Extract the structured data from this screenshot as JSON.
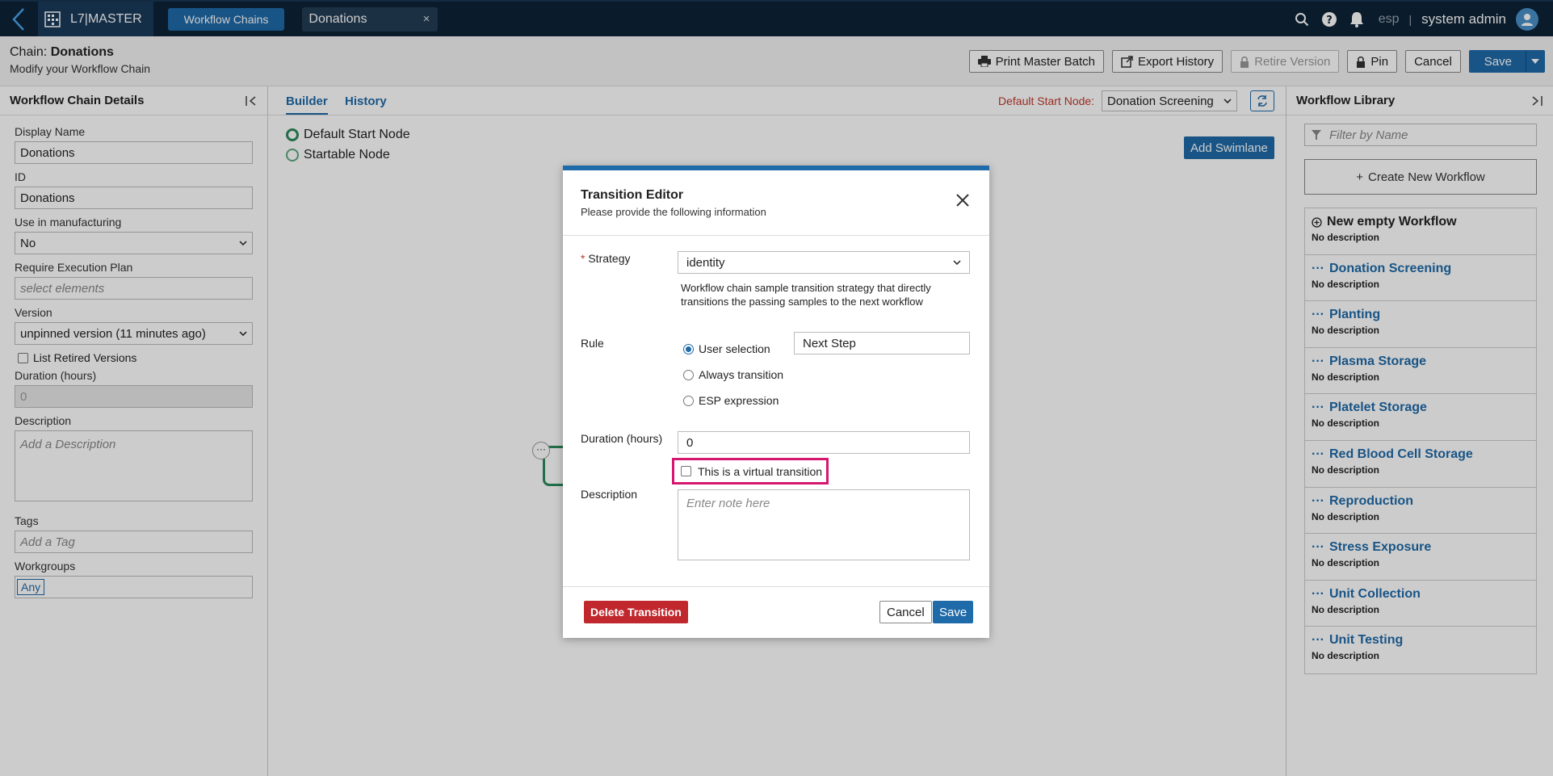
{
  "topbar": {
    "brand": "L7|MASTER",
    "nav_tab": "Workflow Chains",
    "doc_tab": "Donations",
    "doc_tab_close": "×",
    "tenant": "esp",
    "separator": "|",
    "user": "system admin"
  },
  "header": {
    "chain_prefix": "Chain:",
    "chain_name": "Donations",
    "subtitle": "Modify your Workflow Chain",
    "buttons": {
      "print": "Print Master Batch",
      "export": "Export History",
      "retire": "Retire Version",
      "pin": "Pin",
      "cancel": "Cancel",
      "save": "Save"
    }
  },
  "left": {
    "title": "Workflow Chain Details",
    "display_name_label": "Display Name",
    "display_name": "Donations",
    "id_label": "ID",
    "id": "Donations",
    "manufacturing_label": "Use in manufacturing",
    "manufacturing": "No",
    "exec_plan_label": "Require Execution Plan",
    "exec_plan_placeholder": "select elements",
    "version_label": "Version",
    "version": "unpinned version (11 minutes ago)",
    "list_retired": "List Retired Versions",
    "duration_label": "Duration (hours)",
    "duration": "0",
    "description_label": "Description",
    "description_placeholder": "Add a Description",
    "tags_label": "Tags",
    "tags_placeholder": "Add a Tag",
    "workgroups_label": "Workgroups",
    "workgroup": "Any"
  },
  "center": {
    "tab_builder": "Builder",
    "tab_history": "History",
    "default_start_label": "Default Start Node:",
    "default_start_value": "Donation Screening",
    "legend_default": "Default Start Node",
    "legend_startable": "Startable Node",
    "add_swimlane": "Add Swimlane",
    "node_dots": "···"
  },
  "right": {
    "title": "Workflow Library",
    "filter_placeholder": "Filter by Name",
    "create": "Create New Workflow",
    "items": [
      {
        "name": "New empty Workflow",
        "desc": "No description"
      },
      {
        "name": "Donation Screening",
        "desc": "No description"
      },
      {
        "name": "Planting",
        "desc": "No description"
      },
      {
        "name": "Plasma Storage",
        "desc": "No description"
      },
      {
        "name": "Platelet Storage",
        "desc": "No description"
      },
      {
        "name": "Red Blood Cell Storage",
        "desc": "No description"
      },
      {
        "name": "Reproduction",
        "desc": "No description"
      },
      {
        "name": "Stress Exposure",
        "desc": "No description"
      },
      {
        "name": "Unit Collection",
        "desc": "No description"
      },
      {
        "name": "Unit Testing",
        "desc": "No description"
      }
    ]
  },
  "modal": {
    "title": "Transition Editor",
    "subtitle": "Please provide the following information",
    "strategy_req": "*",
    "strategy_label": "Strategy",
    "strategy_value": "identity",
    "strategy_help": "Workflow chain sample transition strategy that directly transitions the passing samples to the next workflow",
    "rule_label": "Rule",
    "rule_user": "User selection",
    "rule_always": "Always transition",
    "rule_esp": "ESP expression",
    "rule_input": "Next Step",
    "duration_label": "Duration (hours)",
    "duration_value": "0",
    "virtual_label": "This is a virtual transition",
    "description_label": "Description",
    "description_placeholder": "Enter note here",
    "delete": "Delete Transition",
    "cancel": "Cancel",
    "save": "Save"
  },
  "colors": {
    "accent": "#1f6aa8",
    "danger": "#c0282e",
    "highlight": "#d6176f",
    "node": "#2c8a5a"
  }
}
